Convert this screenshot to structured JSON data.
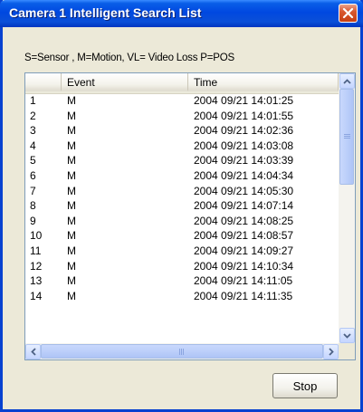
{
  "window": {
    "title": "Camera 1 Intelligent Search List",
    "accent_color": "#0a4fd8",
    "close_icon": "close-icon"
  },
  "legend": {
    "text": "S=Sensor  , M=Motion, VL= Video Loss  P=POS"
  },
  "list": {
    "columns": [
      "",
      "Event",
      "Time"
    ],
    "rows": [
      [
        "1",
        "M",
        "2004 09/21 14:01:25"
      ],
      [
        "2",
        "M",
        "2004 09/21 14:01:55"
      ],
      [
        "3",
        "M",
        "2004 09/21 14:02:36"
      ],
      [
        "4",
        "M",
        "2004 09/21 14:03:08"
      ],
      [
        "5",
        "M",
        "2004 09/21 14:03:39"
      ],
      [
        "6",
        "M",
        "2004 09/21 14:04:34"
      ],
      [
        "7",
        "M",
        "2004 09/21 14:05:30"
      ],
      [
        "8",
        "M",
        "2004 09/21 14:07:14"
      ],
      [
        "9",
        "M",
        "2004 09/21 14:08:25"
      ],
      [
        "10",
        "M",
        "2004 09/21 14:08:57"
      ],
      [
        "11",
        "M",
        "2004 09/21 14:09:27"
      ],
      [
        "12",
        "M",
        "2004 09/21 14:10:34"
      ],
      [
        "13",
        "M",
        "2004 09/21 14:11:05"
      ],
      [
        "14",
        "M",
        "2004 09/21 14:11:35"
      ]
    ]
  },
  "buttons": {
    "stop_label": "Stop"
  }
}
